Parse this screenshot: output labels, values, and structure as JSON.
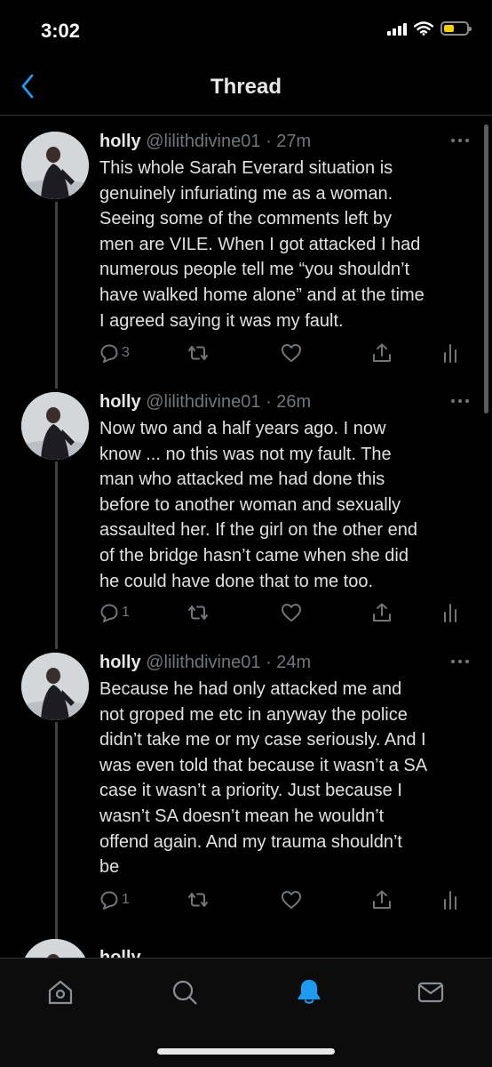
{
  "status_bar": {
    "time": "3:02",
    "battery_level": 0.45
  },
  "header": {
    "title": "Thread"
  },
  "colors": {
    "accent": "#1d9bf0",
    "background": "#000000",
    "divider": "#2f3336",
    "muted": "#71767b",
    "battery": "#f5d000"
  },
  "tweets": [
    {
      "name": "holly",
      "handle": "@lilithdivine01",
      "time": "· 27m",
      "lines": [
        "This whole Sarah Everard situation is",
        "genuinely infuriating me as a woman.",
        "Seeing some of the comments left by",
        "men are VILE. When I got attacked I had",
        "numerous people tell me “you shouldn’t",
        "have walked home alone” and at the time",
        "I agreed saying it was my fault."
      ],
      "reply_count": "3"
    },
    {
      "name": "holly",
      "handle": "@lilithdivine01",
      "time": "· 26m",
      "lines": [
        "Now two and a half years ago. I now",
        "know ... no this was not my fault. The",
        "man who attacked me had done this",
        "before to another woman and sexually",
        "assaulted her. If the girl on the other end",
        "of the bridge hasn’t came when she did",
        "he could have done that to me too."
      ],
      "reply_count": "1"
    },
    {
      "name": "holly",
      "handle": "@lilithdivine01",
      "time": "· 24m",
      "lines": [
        "Because he had only attacked me and",
        "not groped me etc in anyway the police",
        "didn’t take me or my case seriously. And I",
        "was even told that because it wasn’t a SA",
        "case it wasn’t a priority. Just because I",
        "wasn’t SA doesn’t mean he wouldn’t",
        "offend again. And my trauma shouldn’t",
        "be"
      ],
      "reply_count": "1"
    },
    {
      "name": "holly"
    }
  ],
  "tab_bar": {
    "items": [
      {
        "icon": "home-icon"
      },
      {
        "icon": "search-icon"
      },
      {
        "icon": "notifications-bell-icon",
        "active": true
      },
      {
        "icon": "messages-envelope-icon"
      }
    ]
  }
}
